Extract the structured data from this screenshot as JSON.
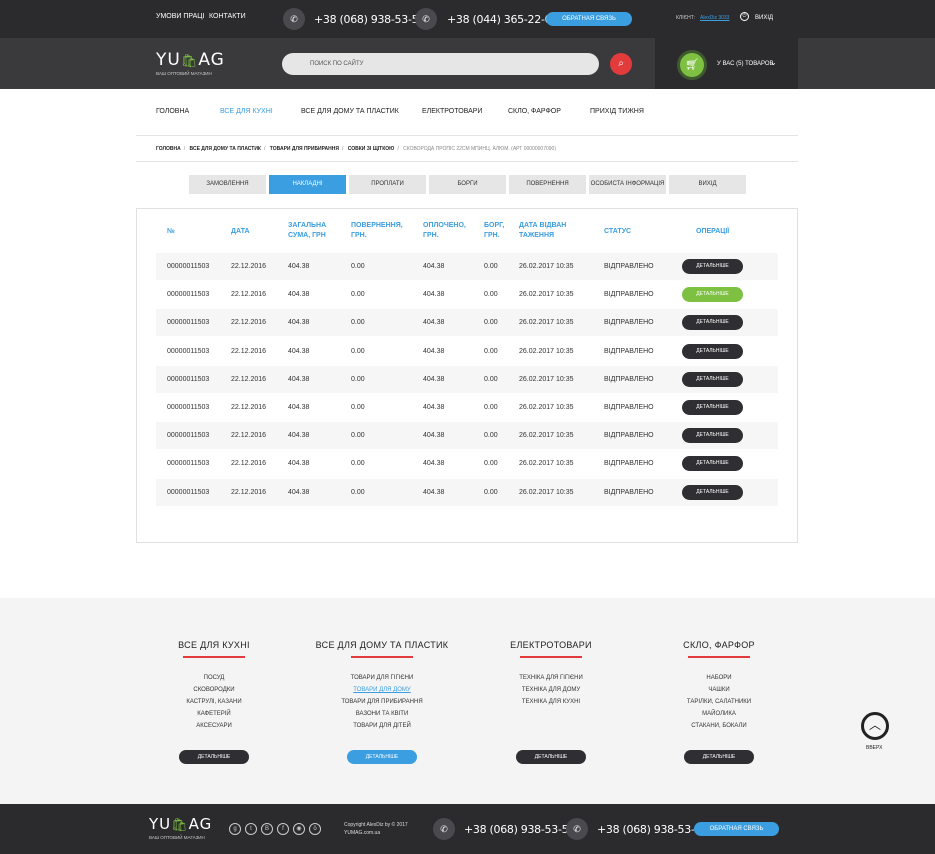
{
  "topbar": {
    "links": [
      "Умови праці",
      "Контакти"
    ],
    "phones": [
      "+38 (068) 938-53-56",
      "+38 (044) 365-22-00"
    ],
    "callback": "Обратная связь",
    "client_label": "Клієнт:",
    "client_name": "AlexDiz 3033",
    "exit": "Вихід"
  },
  "header": {
    "logo_left": "YU",
    "logo_right": "AG",
    "logo_sub": "ваш оптовий магазин",
    "search_placeholder": "Поиск по сайту",
    "cart_text": "У вас (5) товаров"
  },
  "nav": [
    "Головна",
    "Все для кухні",
    "Все для дому та пластик",
    "Електротовари",
    "Скло, фарфор",
    "Прихід тижня"
  ],
  "breadcrumbs": {
    "items": [
      "Головна",
      "Все для дому та пластик",
      "Товари для прибирання",
      "Совки зі щіткою"
    ],
    "current": "Сковорода Пропіс 22см мпинц. алюм. (арт 00000007090)"
  },
  "tabs": [
    "Замовлення",
    "Накладні",
    "Проплати",
    "Борги",
    "Повернення",
    "Особиста інформація",
    "Вихід"
  ],
  "table": {
    "headers": [
      "№",
      "Дата",
      "Загальна сума, грн",
      "Повернення, грн.",
      "Оплочено, грн.",
      "Борг, грн.",
      "Дата відван таження",
      "Статус",
      "Операції"
    ],
    "rows": [
      {
        "no": "00000011503",
        "date": "22.12.2016",
        "sum": "404.38",
        "ret": "0.00",
        "paid": "404.38",
        "debt": "0.00",
        "ship": "26.02.2017 10:35",
        "status": "Відправлено",
        "op": "Детальніше"
      },
      {
        "no": "00000011503",
        "date": "22.12.2016",
        "sum": "404.38",
        "ret": "0.00",
        "paid": "404.38",
        "debt": "0.00",
        "ship": "26.02.2017 10:35",
        "status": "Відправлено",
        "op": "Детальніше"
      },
      {
        "no": "00000011503",
        "date": "22.12.2016",
        "sum": "404.38",
        "ret": "0.00",
        "paid": "404.38",
        "debt": "0.00",
        "ship": "26.02.2017 10:35",
        "status": "Відправлено",
        "op": "Детальніше"
      },
      {
        "no": "00000011503",
        "date": "22.12.2016",
        "sum": "404.38",
        "ret": "0.00",
        "paid": "404.38",
        "debt": "0.00",
        "ship": "26.02.2017 10:35",
        "status": "Відправлено",
        "op": "Детальніше"
      },
      {
        "no": "00000011503",
        "date": "22.12.2016",
        "sum": "404.38",
        "ret": "0.00",
        "paid": "404.38",
        "debt": "0.00",
        "ship": "26.02.2017 10:35",
        "status": "Відправлено",
        "op": "Детальніше"
      },
      {
        "no": "00000011503",
        "date": "22.12.2016",
        "sum": "404.38",
        "ret": "0.00",
        "paid": "404.38",
        "debt": "0.00",
        "ship": "26.02.2017 10:35",
        "status": "Відправлено",
        "op": "Детальніше"
      },
      {
        "no": "00000011503",
        "date": "22.12.2016",
        "sum": "404.38",
        "ret": "0.00",
        "paid": "404.38",
        "debt": "0.00",
        "ship": "26.02.2017 10:35",
        "status": "Відправлено",
        "op": "Детальніше"
      },
      {
        "no": "00000011503",
        "date": "22.12.2016",
        "sum": "404.38",
        "ret": "0.00",
        "paid": "404.38",
        "debt": "0.00",
        "ship": "26.02.2017 10:35",
        "status": "Відправлено",
        "op": "Детальніше"
      },
      {
        "no": "00000011503",
        "date": "22.12.2016",
        "sum": "404.38",
        "ret": "0.00",
        "paid": "404.38",
        "debt": "0.00",
        "ship": "26.02.2017 10:35",
        "status": "Відправлено",
        "op": "Детальніше"
      }
    ]
  },
  "footer": {
    "columns": [
      {
        "title": "Все для кухні",
        "items": [
          "Посуд",
          "Сковородки",
          "Каструлі, казани",
          "Кафетерій",
          "Аксесуари"
        ],
        "button": "Детальніше"
      },
      {
        "title": "Все для дому та пластик",
        "items": [
          "Товари для гігієни",
          "Товари для дому",
          "Товари для прибирання",
          "Вазони та квіти",
          "Товари для дітей"
        ],
        "button": "Детальніше"
      },
      {
        "title": "Електротовари",
        "items": [
          "Техніка для гігієни",
          "Техніка для дому",
          "Техніка для кухні"
        ],
        "button": "Детальніше"
      },
      {
        "title": "Скло, фарфор",
        "items": [
          "Набори",
          "Чашки",
          "Тарілки, салатники",
          "Майолика",
          "Стакани, бокали"
        ],
        "button": "Детальніше"
      }
    ],
    "up_label": "Вверх",
    "copyright_1": "Copyright AlexDiz by © 2017",
    "copyright_2": "YUMAG.com.ua",
    "phones": [
      "+38 (068) 938-53-56",
      "+38 (068) 938-53-56"
    ],
    "callback": "Обратная связь"
  },
  "colors": {
    "accent": "#3a9ee0",
    "green": "#7ec142",
    "red": "#e23b3b",
    "dark": "#2b2b2e"
  }
}
